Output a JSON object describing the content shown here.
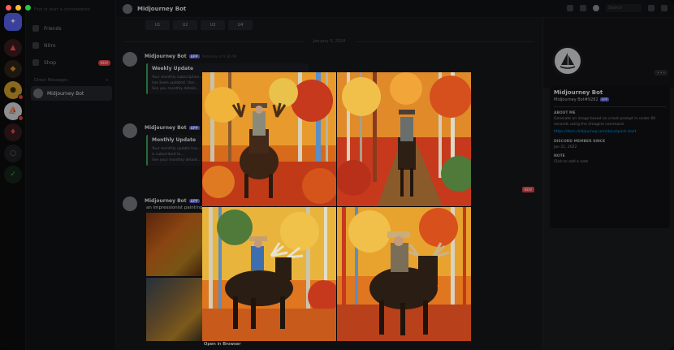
{
  "window": {
    "traffic_colors": [
      "#ff5f57",
      "#febc2e",
      "#28c840"
    ]
  },
  "server_rail": {
    "icons": [
      "discord-home-icon",
      "server-red-icon",
      "server-orange-icon",
      "server-sail-icon",
      "server-red-2-icon",
      "server-dark-icon",
      "server-green-icon"
    ]
  },
  "channels": {
    "search_placeholder": "Find or start a conversation",
    "items": [
      {
        "label": "Friends",
        "icon": "friends-icon"
      },
      {
        "label": "Nitro",
        "icon": "nitro-icon"
      },
      {
        "label": "Shop",
        "icon": "shop-icon",
        "badge": "NEW"
      }
    ],
    "dm_header": "Direct Messages",
    "dm_add": "+",
    "dm_active": "Midjourney Bot"
  },
  "header": {
    "title": "Midjourney Bot",
    "search_placeholder": "Search"
  },
  "chat": {
    "upscale_buttons": [
      "U1",
      "U2",
      "U3",
      "U4"
    ],
    "date_divider": "January 3, 2024",
    "messages": [
      {
        "author": "Midjourney Bot",
        "bot_tag": "APP",
        "time": "Yesterday at 9:36 AM",
        "embed_title": "Weekly Update",
        "embed_lines": [
          "Your monthly subscription...",
          "has been updated. Use...",
          "See you monthly details..."
        ]
      },
      {
        "author": "Midjourney Bot",
        "bot_tag": "APP",
        "time": "",
        "embed_title": "Monthly Update",
        "embed_lines": [
          "Your monthly update has...",
          "is subscribed to...",
          "See your monthly details..."
        ]
      },
      {
        "author": "Midjourney Bot",
        "bot_tag": "APP",
        "time": "",
        "text": "an impressionist painting of a cowboy riding a moose..."
      }
    ],
    "new_tag": "NEW"
  },
  "profile": {
    "name": "Midjourney Bot",
    "tag": "Midjourney Bot#9282",
    "bot_tag": "APP",
    "badge": "• • •",
    "about_header": "ABOUT ME",
    "about_text": "Generate an image based on a text prompt in under 60 seconds using the /imagine command.",
    "link_text": "https://docs.midjourney.com/docs/quick-start",
    "member_since_header": "DISCORD MEMBER SINCE",
    "member_since": "Jan 21, 2022",
    "note_header": "NOTE",
    "note_text": "Click to add a note"
  },
  "viewer": {
    "open_in_browser": "Open in Browser",
    "palette": {
      "orange": "#e0761f",
      "red": "#c7391d",
      "gold": "#e8b53a",
      "green": "#4f7a3a",
      "blue": "#5a8ec4",
      "dark": "#2a1d14"
    }
  }
}
